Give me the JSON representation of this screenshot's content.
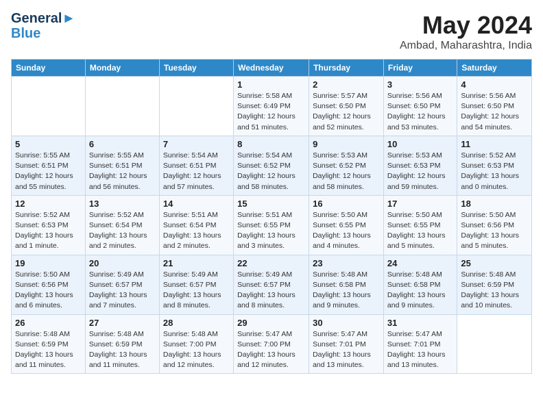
{
  "header": {
    "logo_line1": "General",
    "logo_line2": "Blue",
    "month": "May 2024",
    "location": "Ambad, Maharashtra, India"
  },
  "weekdays": [
    "Sunday",
    "Monday",
    "Tuesday",
    "Wednesday",
    "Thursday",
    "Friday",
    "Saturday"
  ],
  "weeks": [
    [
      {
        "day": "",
        "sunrise": "",
        "sunset": "",
        "daylight": ""
      },
      {
        "day": "",
        "sunrise": "",
        "sunset": "",
        "daylight": ""
      },
      {
        "day": "",
        "sunrise": "",
        "sunset": "",
        "daylight": ""
      },
      {
        "day": "1",
        "sunrise": "Sunrise: 5:58 AM",
        "sunset": "Sunset: 6:49 PM",
        "daylight": "Daylight: 12 hours and 51 minutes."
      },
      {
        "day": "2",
        "sunrise": "Sunrise: 5:57 AM",
        "sunset": "Sunset: 6:50 PM",
        "daylight": "Daylight: 12 hours and 52 minutes."
      },
      {
        "day": "3",
        "sunrise": "Sunrise: 5:56 AM",
        "sunset": "Sunset: 6:50 PM",
        "daylight": "Daylight: 12 hours and 53 minutes."
      },
      {
        "day": "4",
        "sunrise": "Sunrise: 5:56 AM",
        "sunset": "Sunset: 6:50 PM",
        "daylight": "Daylight: 12 hours and 54 minutes."
      }
    ],
    [
      {
        "day": "5",
        "sunrise": "Sunrise: 5:55 AM",
        "sunset": "Sunset: 6:51 PM",
        "daylight": "Daylight: 12 hours and 55 minutes."
      },
      {
        "day": "6",
        "sunrise": "Sunrise: 5:55 AM",
        "sunset": "Sunset: 6:51 PM",
        "daylight": "Daylight: 12 hours and 56 minutes."
      },
      {
        "day": "7",
        "sunrise": "Sunrise: 5:54 AM",
        "sunset": "Sunset: 6:51 PM",
        "daylight": "Daylight: 12 hours and 57 minutes."
      },
      {
        "day": "8",
        "sunrise": "Sunrise: 5:54 AM",
        "sunset": "Sunset: 6:52 PM",
        "daylight": "Daylight: 12 hours and 58 minutes."
      },
      {
        "day": "9",
        "sunrise": "Sunrise: 5:53 AM",
        "sunset": "Sunset: 6:52 PM",
        "daylight": "Daylight: 12 hours and 58 minutes."
      },
      {
        "day": "10",
        "sunrise": "Sunrise: 5:53 AM",
        "sunset": "Sunset: 6:53 PM",
        "daylight": "Daylight: 12 hours and 59 minutes."
      },
      {
        "day": "11",
        "sunrise": "Sunrise: 5:52 AM",
        "sunset": "Sunset: 6:53 PM",
        "daylight": "Daylight: 13 hours and 0 minutes."
      }
    ],
    [
      {
        "day": "12",
        "sunrise": "Sunrise: 5:52 AM",
        "sunset": "Sunset: 6:53 PM",
        "daylight": "Daylight: 13 hours and 1 minute."
      },
      {
        "day": "13",
        "sunrise": "Sunrise: 5:52 AM",
        "sunset": "Sunset: 6:54 PM",
        "daylight": "Daylight: 13 hours and 2 minutes."
      },
      {
        "day": "14",
        "sunrise": "Sunrise: 5:51 AM",
        "sunset": "Sunset: 6:54 PM",
        "daylight": "Daylight: 13 hours and 2 minutes."
      },
      {
        "day": "15",
        "sunrise": "Sunrise: 5:51 AM",
        "sunset": "Sunset: 6:55 PM",
        "daylight": "Daylight: 13 hours and 3 minutes."
      },
      {
        "day": "16",
        "sunrise": "Sunrise: 5:50 AM",
        "sunset": "Sunset: 6:55 PM",
        "daylight": "Daylight: 13 hours and 4 minutes."
      },
      {
        "day": "17",
        "sunrise": "Sunrise: 5:50 AM",
        "sunset": "Sunset: 6:55 PM",
        "daylight": "Daylight: 13 hours and 5 minutes."
      },
      {
        "day": "18",
        "sunrise": "Sunrise: 5:50 AM",
        "sunset": "Sunset: 6:56 PM",
        "daylight": "Daylight: 13 hours and 5 minutes."
      }
    ],
    [
      {
        "day": "19",
        "sunrise": "Sunrise: 5:50 AM",
        "sunset": "Sunset: 6:56 PM",
        "daylight": "Daylight: 13 hours and 6 minutes."
      },
      {
        "day": "20",
        "sunrise": "Sunrise: 5:49 AM",
        "sunset": "Sunset: 6:57 PM",
        "daylight": "Daylight: 13 hours and 7 minutes."
      },
      {
        "day": "21",
        "sunrise": "Sunrise: 5:49 AM",
        "sunset": "Sunset: 6:57 PM",
        "daylight": "Daylight: 13 hours and 8 minutes."
      },
      {
        "day": "22",
        "sunrise": "Sunrise: 5:49 AM",
        "sunset": "Sunset: 6:57 PM",
        "daylight": "Daylight: 13 hours and 8 minutes."
      },
      {
        "day": "23",
        "sunrise": "Sunrise: 5:48 AM",
        "sunset": "Sunset: 6:58 PM",
        "daylight": "Daylight: 13 hours and 9 minutes."
      },
      {
        "day": "24",
        "sunrise": "Sunrise: 5:48 AM",
        "sunset": "Sunset: 6:58 PM",
        "daylight": "Daylight: 13 hours and 9 minutes."
      },
      {
        "day": "25",
        "sunrise": "Sunrise: 5:48 AM",
        "sunset": "Sunset: 6:59 PM",
        "daylight": "Daylight: 13 hours and 10 minutes."
      }
    ],
    [
      {
        "day": "26",
        "sunrise": "Sunrise: 5:48 AM",
        "sunset": "Sunset: 6:59 PM",
        "daylight": "Daylight: 13 hours and 11 minutes."
      },
      {
        "day": "27",
        "sunrise": "Sunrise: 5:48 AM",
        "sunset": "Sunset: 6:59 PM",
        "daylight": "Daylight: 13 hours and 11 minutes."
      },
      {
        "day": "28",
        "sunrise": "Sunrise: 5:48 AM",
        "sunset": "Sunset: 7:00 PM",
        "daylight": "Daylight: 13 hours and 12 minutes."
      },
      {
        "day": "29",
        "sunrise": "Sunrise: 5:47 AM",
        "sunset": "Sunset: 7:00 PM",
        "daylight": "Daylight: 13 hours and 12 minutes."
      },
      {
        "day": "30",
        "sunrise": "Sunrise: 5:47 AM",
        "sunset": "Sunset: 7:01 PM",
        "daylight": "Daylight: 13 hours and 13 minutes."
      },
      {
        "day": "31",
        "sunrise": "Sunrise: 5:47 AM",
        "sunset": "Sunset: 7:01 PM",
        "daylight": "Daylight: 13 hours and 13 minutes."
      },
      {
        "day": "",
        "sunrise": "",
        "sunset": "",
        "daylight": ""
      }
    ]
  ]
}
